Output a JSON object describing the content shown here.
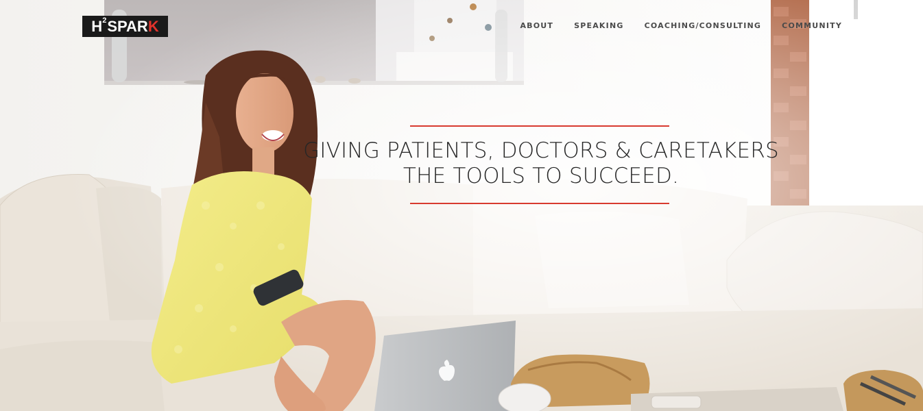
{
  "brand": {
    "logo_h": "H",
    "logo_sup": "2",
    "logo_spar": "SPAR",
    "logo_k": "K",
    "logo_dark": "#1a1a1a",
    "logo_accent": "#e0322b"
  },
  "nav": {
    "items": [
      {
        "label": "ABOUT"
      },
      {
        "label": "SPEAKING"
      },
      {
        "label": "COACHING/CONSULTING"
      },
      {
        "label": "COMMUNITY"
      }
    ]
  },
  "hero": {
    "headline_line1": "GIVING PATIENTS, DOCTORS & CARETAKERS",
    "headline_line2": "THE TOOLS TO SUCCEED.",
    "rule_color": "#d83a2f"
  }
}
